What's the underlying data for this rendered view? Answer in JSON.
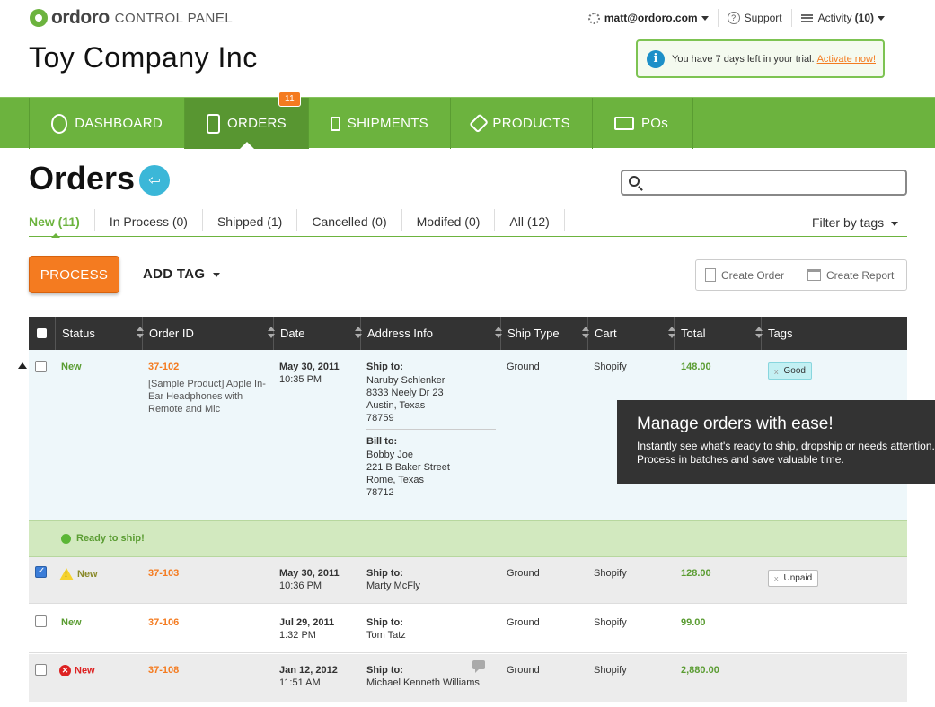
{
  "brand": {
    "name": "ordoro",
    "sub": "CONTROL PANEL"
  },
  "company_name": "Toy Company Inc",
  "topnav": {
    "user": "matt@ordoro.com",
    "support": "Support",
    "activity_label": "Activity",
    "activity_count": "(10)"
  },
  "trial": {
    "text": "You have 7 days left in your trial.",
    "link": "Activate now!"
  },
  "mainnav": {
    "tabs": [
      {
        "label": "DASHBOARD"
      },
      {
        "label": "ORDERS",
        "badge": "11"
      },
      {
        "label": "SHIPMENTS"
      },
      {
        "label": "PRODUCTS"
      },
      {
        "label": "POs"
      }
    ]
  },
  "page": {
    "title": "Orders",
    "search_placeholder": ""
  },
  "filter_tabs": [
    "New (11)",
    "In Process (0)",
    "Shipped (1)",
    "Cancelled (0)",
    "Modifed (0)",
    "All (12)"
  ],
  "filter_by_tags": "Filter by tags",
  "actions": {
    "process": "PROCESS",
    "add_tag": "ADD TAG",
    "create_order": "Create Order",
    "create_report": "Create Report"
  },
  "table": {
    "headers": [
      "Status",
      "Order ID",
      "Date",
      "Address Info",
      "Ship Type",
      "Cart",
      "Total",
      "Tags"
    ],
    "rows": [
      {
        "status": "New",
        "order_id": "37-102",
        "product": "[Sample Product] Apple In-Ear Headphones with Remote and Mic",
        "date": "May 30, 2011",
        "time": "10:35 PM",
        "ship_to_label": "Ship to:",
        "ship_to": [
          "Naruby Schlenker",
          "8333 Neely Dr 23",
          "Austin, Texas",
          "78759"
        ],
        "bill_to_label": "Bill to:",
        "bill_to": [
          "Bobby Joe",
          "221 B Baker Street",
          "Rome, Texas",
          "78712"
        ],
        "ship_type": "Ground",
        "cart": "Shopify",
        "total": "148.00",
        "tag": "Good"
      },
      {
        "status": "New",
        "order_id": "37-103",
        "date": "May 30, 2011",
        "time": "10:36 PM",
        "ship_to_label": "Ship to:",
        "ship_to": [
          "Marty McFly"
        ],
        "ship_type": "Ground",
        "cart": "Shopify",
        "total": "128.00",
        "tag": "Unpaid"
      },
      {
        "status": "New",
        "order_id": "37-106",
        "date": "Jul 29, 2011",
        "time": "1:32 PM",
        "ship_to_label": "Ship to:",
        "ship_to": [
          "Tom Tatz"
        ],
        "ship_type": "Ground",
        "cart": "Shopify",
        "total": "99.00"
      },
      {
        "status": "New",
        "order_id": "37-108",
        "date": "Jan 12, 2012",
        "time": "11:51 AM",
        "ship_to_label": "Ship to:",
        "ship_to": [
          "Michael Kenneth Williams"
        ],
        "ship_type": "Ground",
        "cart": "Shopify",
        "total": "2,880.00"
      }
    ],
    "ready_text": "Ready to ship!"
  },
  "tooltip": {
    "title": "Manage orders with ease!",
    "body": "Instantly see what's ready to ship, dropship or needs attention. Process in batches and save valuable time."
  },
  "colors": {
    "brand_green": "#6cb33e",
    "accent_orange": "#f47b20",
    "header_dark": "#333333"
  }
}
